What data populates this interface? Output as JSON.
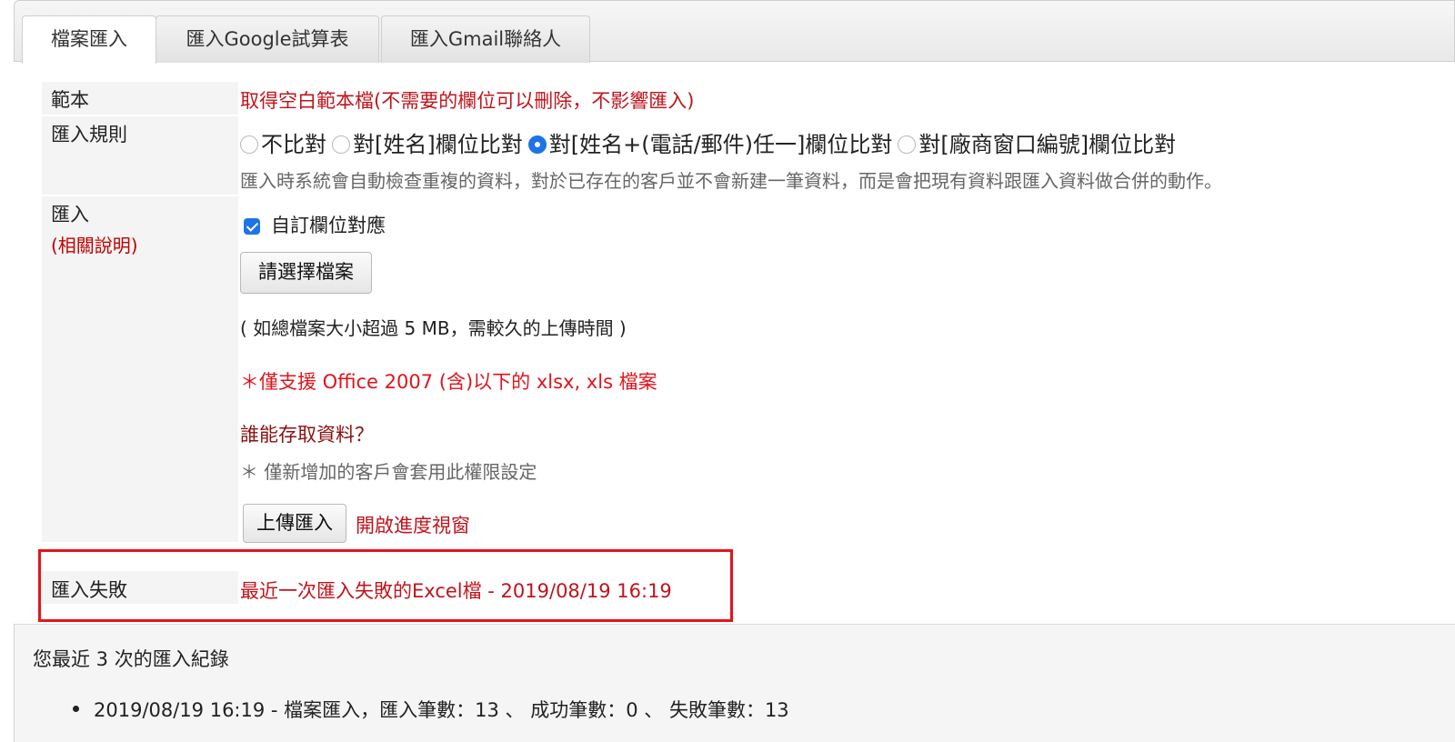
{
  "tabs": [
    {
      "label": "檔案匯入",
      "active": true
    },
    {
      "label": "匯入Google試算表",
      "active": false
    },
    {
      "label": "匯入Gmail聯絡人",
      "active": false
    }
  ],
  "template_row": {
    "label": "範本",
    "link": "取得空白範本檔(不需要的欄位可以刪除，不影響匯入)"
  },
  "rule_row": {
    "label": "匯入規則",
    "options": [
      {
        "label": "不比對",
        "checked": false
      },
      {
        "label": "對[姓名]欄位比對",
        "checked": false
      },
      {
        "label": "對[姓名+(電話/郵件)任一]欄位比對",
        "checked": true
      },
      {
        "label": "對[廠商窗口編號]欄位比對",
        "checked": false
      }
    ],
    "note": "匯入時系統會自動檢查重複的資料，對於已存在的客戶並不會新建一筆資料，而是會把現有資料跟匯入資料做合併的動作。"
  },
  "import_row": {
    "label": "匯入",
    "help_link": "(相關說明)",
    "custom_mapping_label": "自訂欄位對應",
    "custom_mapping_checked": true,
    "choose_file_button": "請選擇檔案",
    "size_note": "( 如總檔案大小超過 5 MB，需較久的上傳時間 )",
    "support_note": "＊僅支援 Office 2007 (含)以下的 xlsx, xls 檔案",
    "access_title": "誰能存取資料？",
    "access_note": "＊ 僅新增加的客戶會套用此權限設定",
    "upload_button": "上傳匯入",
    "progress_link": "開啟進度視窗"
  },
  "fail_row": {
    "label": "匯入失敗",
    "link": "最近一次匯入失敗的Excel檔 - 2019/08/19 16:19"
  },
  "history": {
    "title": "您最近 3 次的匯入紀錄",
    "items": [
      "2019/08/19 16:19 - 檔案匯入，匯入筆數：13 、 成功筆數：0 、 失敗筆數：13"
    ]
  },
  "colors": {
    "accent_red": "#c0141c",
    "highlight_border": "#e3141c",
    "radio_checked": "#1e74e6"
  }
}
